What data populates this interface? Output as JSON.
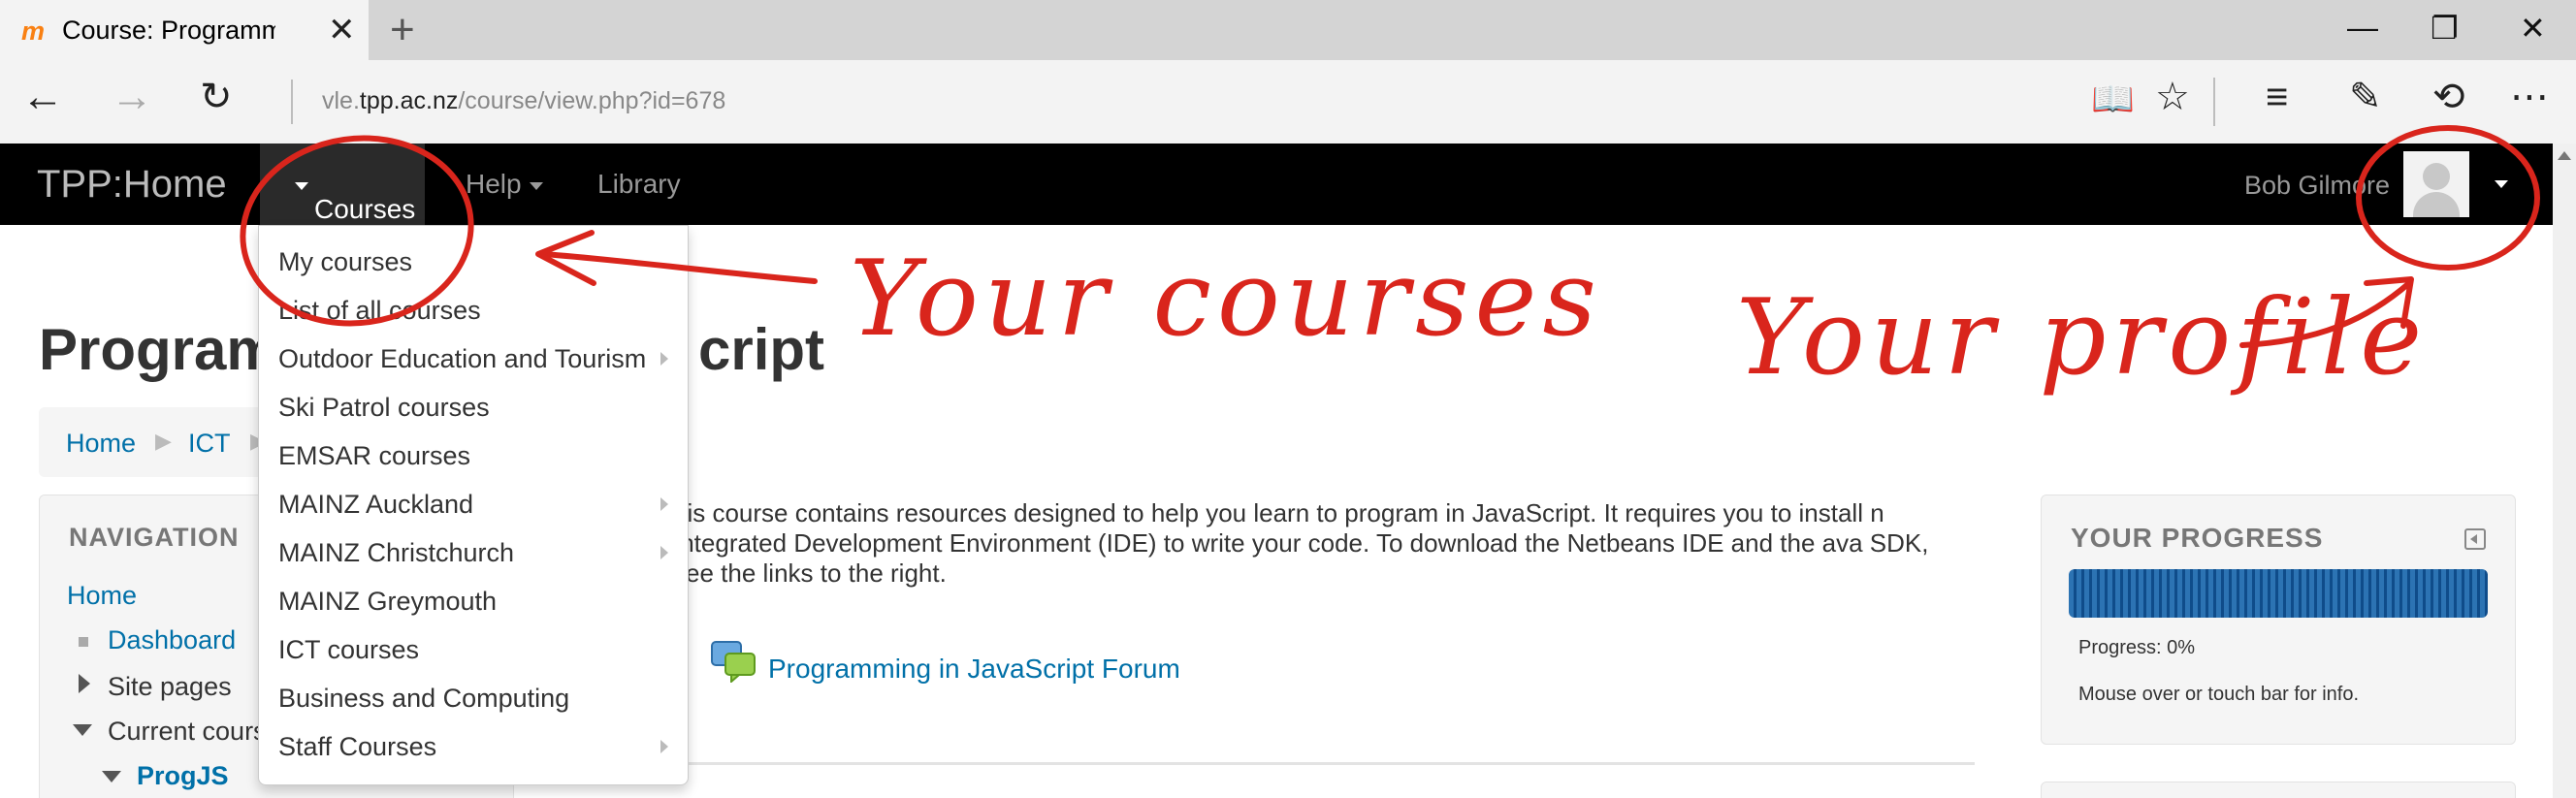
{
  "browser": {
    "tab_title": "Course: Programming in JavaScript",
    "favicon": "moodle-icon",
    "url_prefix": "vle.",
    "url_host": "tpp.ac.nz",
    "url_path": "/course/view.php?id=678"
  },
  "navbar": {
    "brand": "TPP:Home",
    "items": [
      {
        "label": "Courses",
        "active": true
      },
      {
        "label": "Help"
      },
      {
        "label": "Library"
      }
    ],
    "user_name": "Bob Gilmore"
  },
  "courses_menu": [
    {
      "label": "My courses",
      "submenu": false
    },
    {
      "label": "List of all courses",
      "submenu": false
    },
    {
      "label": "Outdoor Education and Tourism",
      "submenu": true
    },
    {
      "label": "Ski Patrol courses",
      "submenu": false
    },
    {
      "label": "EMSAR courses",
      "submenu": false
    },
    {
      "label": "MAINZ Auckland",
      "submenu": true
    },
    {
      "label": "MAINZ Christchurch",
      "submenu": true
    },
    {
      "label": "MAINZ Greymouth",
      "submenu": false
    },
    {
      "label": "ICT courses",
      "submenu": false
    },
    {
      "label": "Business and Computing",
      "submenu": false
    },
    {
      "label": "Staff Courses",
      "submenu": true
    }
  ],
  "page": {
    "title_visible_left": "Program",
    "title_visible_right": "cript",
    "breadcrumb": {
      "home": "Home",
      "ict": "ICT"
    }
  },
  "navigation_block": {
    "title": "NAVIGATION",
    "home": "Home",
    "dashboard": "Dashboard",
    "site_pages": "Site pages",
    "current_courses": "Current cours",
    "current_course": "ProgJS"
  },
  "course_summary": "his course contains resources designed to help you learn to program in JavaScript. It requires you to install n Integrated Development Environment (IDE) to write your code. To download the Netbeans IDE and the ava SDK, see the links to the right.",
  "forum_link": "Programming in JavaScript Forum",
  "progress_block": {
    "title": "YOUR PROGRESS",
    "progress_text": "Progress: 0%",
    "progress_value": 0,
    "info_text": "Mouse over or touch bar for info."
  },
  "annotations": {
    "courses_note": "Your courses",
    "profile_note": "Your profile",
    "color": "#d9251c"
  },
  "colors": {
    "navbar_bg": "#000000",
    "link": "#0070a8",
    "progress_bar": "#1f63a6"
  }
}
